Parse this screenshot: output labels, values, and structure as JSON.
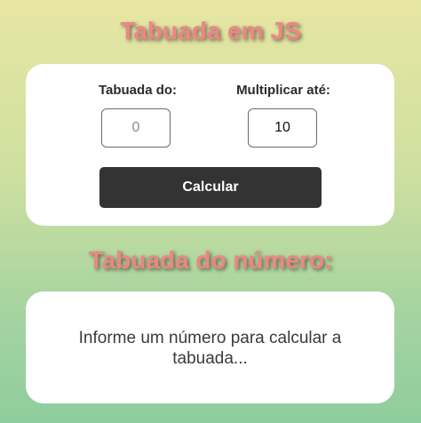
{
  "header": {
    "title": "Tabuada em JS"
  },
  "form": {
    "base_label": "Tabuada do:",
    "base_placeholder": "0",
    "base_value": "",
    "limit_label": "Multiplicar até:",
    "limit_value": "10",
    "calculate_label": "Calcular"
  },
  "result": {
    "title": "Tabuada do número:",
    "message": "Informe um número para calcular a tabuada..."
  },
  "colors": {
    "title": "#ee8585",
    "button_bg": "#333333",
    "card_bg": "#ffffff"
  }
}
